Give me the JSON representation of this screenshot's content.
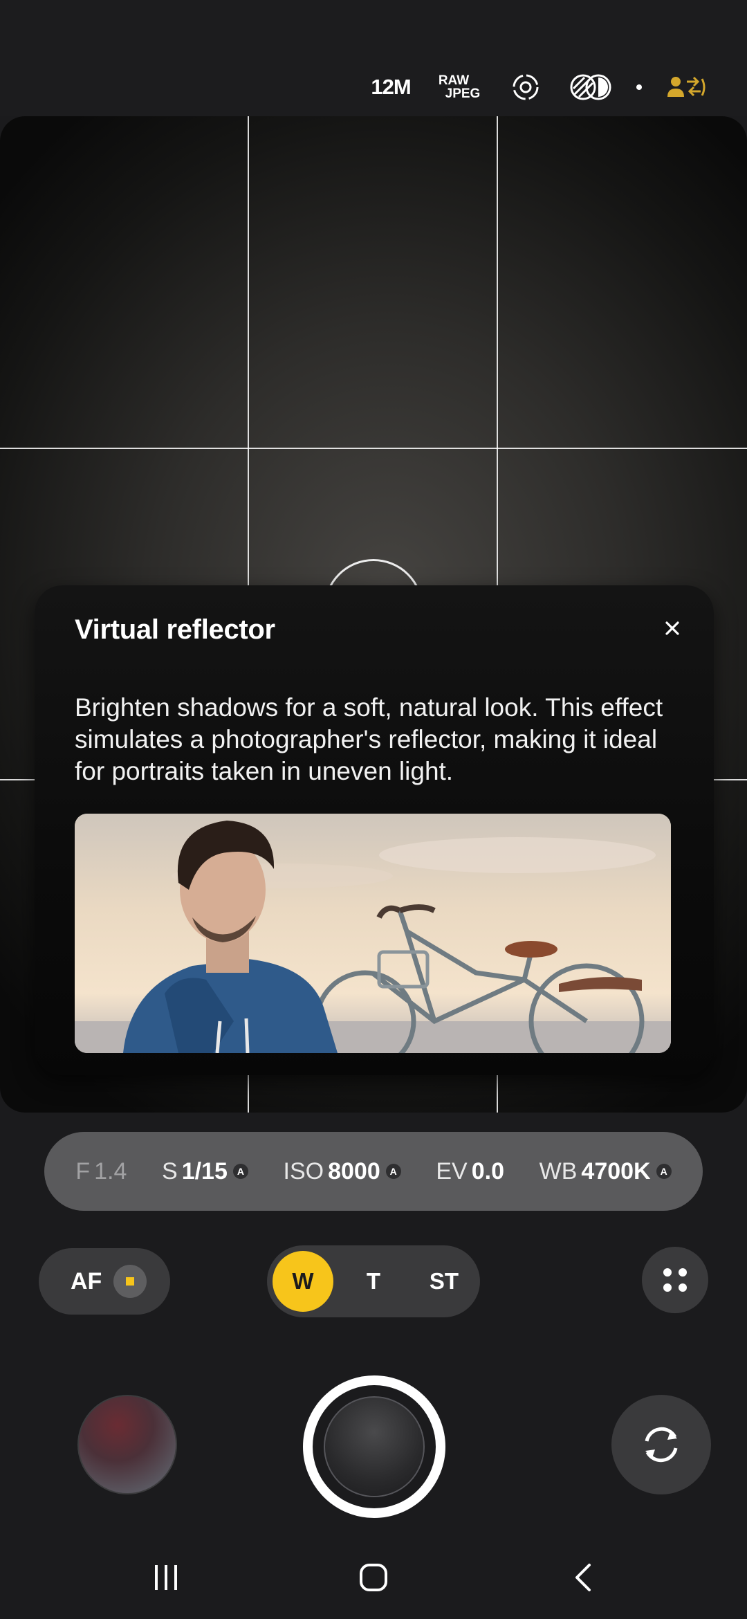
{
  "topbar": {
    "resolution": "12M",
    "format_line1": "RAW",
    "format_line2": "JPEG",
    "icons": [
      "focus-target-icon",
      "filter-icon",
      "dot-indicator",
      "user-swap-icon"
    ],
    "accent_color": "#d4a72c"
  },
  "tooltip": {
    "title": "Virtual reflector",
    "description": "Brighten shadows for a soft, natural look. This effect simulates a photographer's reflector, making it ideal for portraits taken in uneven light.",
    "close_icon": "close-icon",
    "preview_image": "portrait-with-bicycle-illustration"
  },
  "pro_settings": {
    "aperture": {
      "label": "F",
      "value": "1.4"
    },
    "shutter": {
      "label": "S",
      "value": "1/15",
      "auto": "A"
    },
    "iso": {
      "label": "ISO",
      "value": "8000",
      "auto": "A"
    },
    "ev": {
      "label": "EV",
      "value": "0.0"
    },
    "wb": {
      "label": "WB",
      "value": "4700K",
      "auto": "A"
    }
  },
  "controls": {
    "af_label": "AF",
    "af_indicator_color": "#f7c51b",
    "lenses": [
      {
        "label": "W",
        "active": true
      },
      {
        "label": "T",
        "active": false
      },
      {
        "label": "ST",
        "active": false
      }
    ],
    "more_icon": "four-dots-icon"
  },
  "shutter_row": {
    "gallery_icon": "gallery-thumbnail",
    "shutter_icon": "shutter-button",
    "switch_icon": "switch-camera-icon"
  },
  "navbar": {
    "icons": [
      "recent-apps-icon",
      "home-icon",
      "back-icon"
    ]
  },
  "colors": {
    "background": "#1b1b1d",
    "pill": "#3a3a3c",
    "pro_bar": "#5a5a5c",
    "accent": "#f7c51b"
  }
}
